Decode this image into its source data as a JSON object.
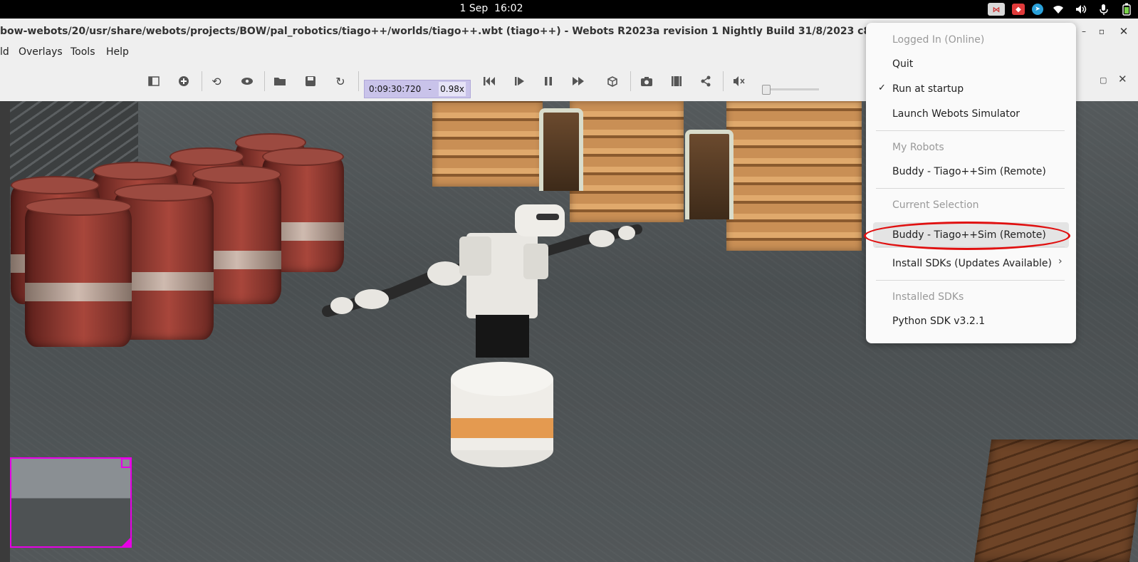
{
  "system_bar": {
    "date": "1 Sep",
    "time": "16:02"
  },
  "window": {
    "title": "bow-webots/20/usr/share/webots/projects/BOW/pal_robotics/tiago++/worlds/tiago++.wbt (tiago++) - Webots R2023a revision 1 Nightly Build 31/8/2023 c8e033c6d8e290ea82"
  },
  "menubar": {
    "items": [
      {
        "label": "ld"
      },
      {
        "label": "Overlays"
      },
      {
        "label": "Tools"
      },
      {
        "label": "Help"
      }
    ]
  },
  "toolbar": {
    "sim_time": "0:09:30:720",
    "separator": "-",
    "speed": "0.98x"
  },
  "tray_menu": {
    "logged_in": "Logged In (Online)",
    "quit": "Quit",
    "run_at_startup": "Run at startup",
    "check_mark": "✓",
    "launch": "Launch Webots Simulator",
    "my_robots_header": "My Robots",
    "my_robot_1": "Buddy - Tiago++Sim (Remote)",
    "current_selection_header": "Current Selection",
    "current_selection": "Buddy - Tiago++Sim (Remote)",
    "install_sdks": "Install SDKs (Updates Available)",
    "installed_sdks_header": "Installed SDKs",
    "python_sdk": "Python SDK v3.2.1"
  },
  "colors": {
    "annotation": "#e01010",
    "overview_border": "#e600e6",
    "time_box": "#c9c3ea"
  }
}
